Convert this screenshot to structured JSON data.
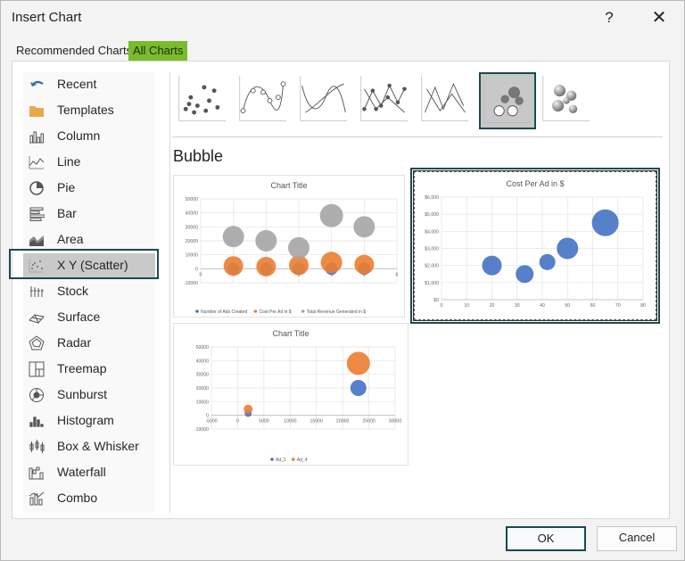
{
  "dialog": {
    "title": "Insert Chart",
    "help": "?",
    "close": "✕"
  },
  "tabs": {
    "recommended": "Recommended Charts",
    "all": "All Charts"
  },
  "sidebar": {
    "items": [
      {
        "label": "Recent",
        "icon": "undo-arrow-icon"
      },
      {
        "label": "Templates",
        "icon": "folder-icon"
      },
      {
        "label": "Column",
        "icon": "column-chart-icon"
      },
      {
        "label": "Line",
        "icon": "line-chart-icon"
      },
      {
        "label": "Pie",
        "icon": "pie-chart-icon"
      },
      {
        "label": "Bar",
        "icon": "bar-chart-icon"
      },
      {
        "label": "Area",
        "icon": "area-chart-icon"
      },
      {
        "label": "X Y (Scatter)",
        "icon": "scatter-chart-icon",
        "selected": true
      },
      {
        "label": "Stock",
        "icon": "stock-chart-icon"
      },
      {
        "label": "Surface",
        "icon": "surface-chart-icon"
      },
      {
        "label": "Radar",
        "icon": "radar-chart-icon"
      },
      {
        "label": "Treemap",
        "icon": "treemap-chart-icon"
      },
      {
        "label": "Sunburst",
        "icon": "sunburst-chart-icon"
      },
      {
        "label": "Histogram",
        "icon": "histogram-chart-icon"
      },
      {
        "label": "Box & Whisker",
        "icon": "box-whisker-chart-icon"
      },
      {
        "label": "Waterfall",
        "icon": "waterfall-chart-icon"
      },
      {
        "label": "Combo",
        "icon": "combo-chart-icon"
      }
    ]
  },
  "subtypes": [
    {
      "name": "scatter",
      "icon": "scatter-subtype-icon"
    },
    {
      "name": "scatter-smooth-lines-markers",
      "icon": "scatter-smooth-markers-icon"
    },
    {
      "name": "scatter-smooth-lines",
      "icon": "scatter-smooth-lines-icon"
    },
    {
      "name": "scatter-straight-lines-markers",
      "icon": "scatter-straight-markers-icon"
    },
    {
      "name": "scatter-straight-lines",
      "icon": "scatter-straight-lines-icon"
    },
    {
      "name": "bubble",
      "icon": "bubble-subtype-icon",
      "selected": true
    },
    {
      "name": "bubble-3d",
      "icon": "bubble-3d-subtype-icon"
    }
  ],
  "section_title": "Bubble",
  "colors": {
    "blue": "#4472c4",
    "orange": "#ed7d31",
    "gray": "#a5a5a5",
    "accent_green": "#7cbb2d",
    "selection": "#1a4a52"
  },
  "chart_data": [
    {
      "type": "bubble",
      "title": "Chart Title",
      "yticks": [
        "50000",
        "40000",
        "30000",
        "20000",
        "10000",
        "0",
        "-10000"
      ],
      "xticks": [
        "0",
        "1",
        "2",
        "3",
        "4",
        "5",
        "6"
      ],
      "ylim": [
        -10000,
        50000
      ],
      "xlim": [
        0,
        6
      ],
      "series": [
        {
          "name": "Number of Ads Created",
          "color": "blue",
          "points": [
            [
              1,
              0,
              7
            ],
            [
              2,
              0,
              7
            ],
            [
              3,
              0,
              7
            ],
            [
              4,
              0,
              7
            ],
            [
              5,
              0,
              7
            ]
          ]
        },
        {
          "name": "Cost Per Ad in $",
          "color": "orange",
          "points": [
            [
              1,
              2000,
              11
            ],
            [
              2,
              1500,
              11
            ],
            [
              3,
              2500,
              11
            ],
            [
              4,
              4500,
              12
            ],
            [
              5,
              3000,
              11
            ]
          ]
        },
        {
          "name": "Total Revenue Generated in $",
          "color": "gray",
          "points": [
            [
              1,
              23000,
              12
            ],
            [
              2,
              20000,
              12
            ],
            [
              3,
              15000,
              12
            ],
            [
              4,
              38000,
              13
            ],
            [
              5,
              30000,
              12
            ]
          ]
        }
      ],
      "legend": "bottom"
    },
    {
      "type": "bubble",
      "title": "Cost Per Ad in $",
      "yticks": [
        "$6,000",
        "$5,000",
        "$4,000",
        "$3,000",
        "$2,000",
        "$1,000",
        "$0"
      ],
      "xticks": [
        "0",
        "10",
        "20",
        "30",
        "40",
        "50",
        "60",
        "70",
        "80"
      ],
      "ylim": [
        0,
        6000
      ],
      "xlim": [
        0,
        80
      ],
      "series": [
        {
          "name": "Cost Per Ad in $",
          "color": "blue",
          "points": [
            [
              20,
              2000,
              11
            ],
            [
              33,
              1500,
              10
            ],
            [
              42,
              2200,
              9
            ],
            [
              50,
              3000,
              12
            ],
            [
              65,
              4500,
              15
            ]
          ]
        }
      ],
      "legend": "none"
    },
    {
      "type": "bubble",
      "title": "Chart Title",
      "yticks": [
        "50000",
        "40000",
        "30000",
        "20000",
        "10000",
        "0",
        "-10000"
      ],
      "xticks": [
        "-5000",
        "0",
        "5000",
        "10000",
        "15000",
        "20000",
        "25000",
        "30000"
      ],
      "ylim": [
        -10000,
        50000
      ],
      "xlim": [
        -5000,
        30000
      ],
      "series": [
        {
          "name": "Ad_2",
          "color": "blue",
          "points": [
            [
              2000,
              1500,
              4
            ],
            [
              23000,
              20000,
              9
            ]
          ]
        },
        {
          "name": "Ad_4",
          "color": "orange",
          "points": [
            [
              2000,
              4500,
              5
            ],
            [
              23000,
              38000,
              13
            ]
          ]
        }
      ],
      "legend": "bottom"
    }
  ],
  "buttons": {
    "ok": "OK",
    "cancel": "Cancel"
  }
}
